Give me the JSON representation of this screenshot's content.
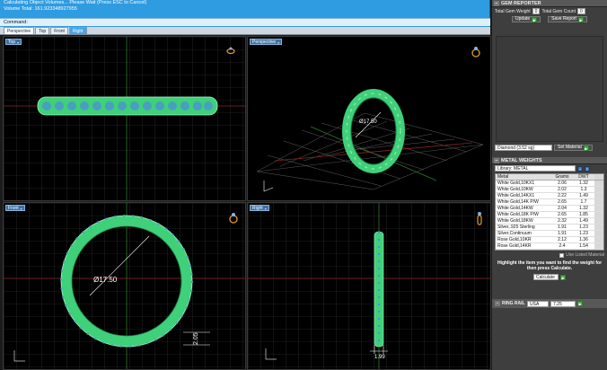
{
  "command": {
    "line1": "Calculating Object Volumes... Please Wait (Press ESC to Cancel)",
    "line2": "Volume Total: 161.923348927955",
    "prompt": "Command:"
  },
  "tabs": [
    "Perspective",
    "Top",
    "Front",
    "Right"
  ],
  "viewports": {
    "top": "Top",
    "perspective": "Perspective",
    "front": "Front",
    "right": "Right"
  },
  "front_dims": {
    "diameter": "Ø17.50",
    "width": "2.05"
  },
  "persp_dims": {
    "diameter": "Ø17.50"
  },
  "right_dims": {
    "width": "1.99"
  },
  "gem_reporter": {
    "title": "GEM REPORTER",
    "total_weight_label": "Total Gem Weight",
    "total_weight": "0",
    "total_count_label": "Total Gem Count",
    "total_count": "0",
    "update_label": "Update",
    "save_label": "Save Report",
    "material": "Diamond  (3.52 sg)",
    "set_material_label": "Set Material"
  },
  "metal_weights": {
    "title": "METAL WEIGHTS",
    "library_label": "Library:  METAL",
    "columns": [
      "Metal",
      "Grams",
      "DWT"
    ],
    "rows": [
      [
        "White Gold,10KX1",
        "2.06",
        "1.32"
      ],
      [
        "White Gold,10KW",
        "2.02",
        "1.3"
      ],
      [
        "White Gold,14KX1",
        "2.22",
        "1.49"
      ],
      [
        "White Gold,14K P/W",
        "2.65",
        "1.7"
      ],
      [
        "White Gold,14KW",
        "2.04",
        "1.32"
      ],
      [
        "White Gold,18K P/W",
        "2.65",
        "1.85"
      ],
      [
        "White Gold,18KW",
        "2.32",
        "1.49"
      ],
      [
        "Silver,.925 Sterling",
        "1.91",
        "1.23"
      ],
      [
        "Silver,Continuum",
        "1.91",
        "1.23"
      ],
      [
        "Rose Gold,10KR",
        "2.12",
        "1.36"
      ],
      [
        "Rose Gold,14KR",
        "2.4",
        "1.54"
      ]
    ],
    "checkbox_label": "Use Listed Material",
    "instructions": "Highlight the item you want to find the weight for then press Calculate.",
    "calculate_label": "Calculate"
  },
  "ring_rail": {
    "label": "RING RAIL",
    "system": "USA",
    "size": "7.25"
  }
}
